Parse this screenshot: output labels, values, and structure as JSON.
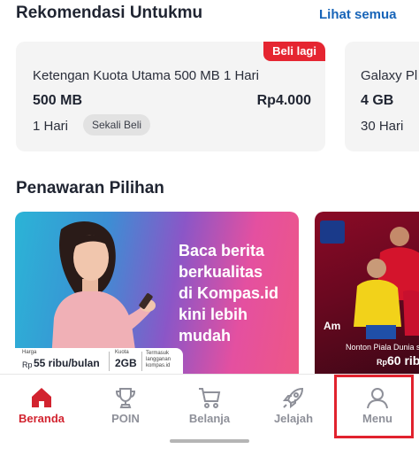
{
  "recommendations": {
    "title": "Rekomendasi Untukmu",
    "see_all": "Lihat semua",
    "cards": [
      {
        "badge": "Beli lagi",
        "name": "Ketengan Kuota Utama 500 MB 1 Hari",
        "size": "500 MB",
        "price": "Rp4.000",
        "duration": "1 Hari",
        "chip": "Sekali Beli"
      },
      {
        "name": "Galaxy Pl",
        "size": "4 GB",
        "duration": "30 Hari"
      }
    ]
  },
  "offers": {
    "title": "Penawaran Pilihan",
    "banners": [
      {
        "headline": [
          "Baca berita",
          "berkualitas",
          "di Kompas.id",
          "kini lebih",
          "mudah"
        ],
        "price_label": "Harga",
        "price_prefix": "Rp",
        "price_value": "55 ribu/bulan",
        "quota_label": "Kuota",
        "quota_value": "2GB",
        "note": "Termasuk langganan kompas.id"
      },
      {
        "am": "Am",
        "caption": "Nonton Piala Dunia sa",
        "price_prefix": "Rp",
        "price_value": "60 ribu"
      }
    ]
  },
  "bottom_nav": {
    "items": [
      {
        "label": "Beranda",
        "icon": "home-icon",
        "active": true
      },
      {
        "label": "POIN",
        "icon": "trophy-icon",
        "active": false
      },
      {
        "label": "Belanja",
        "icon": "cart-icon",
        "active": false
      },
      {
        "label": "Jelajah",
        "icon": "rocket-icon",
        "active": false
      },
      {
        "label": "Menu",
        "icon": "user-icon",
        "active": false
      }
    ]
  },
  "colors": {
    "brand_red": "#d2232f",
    "link_blue": "#1764b8",
    "inactive_gray": "#8e9099"
  }
}
